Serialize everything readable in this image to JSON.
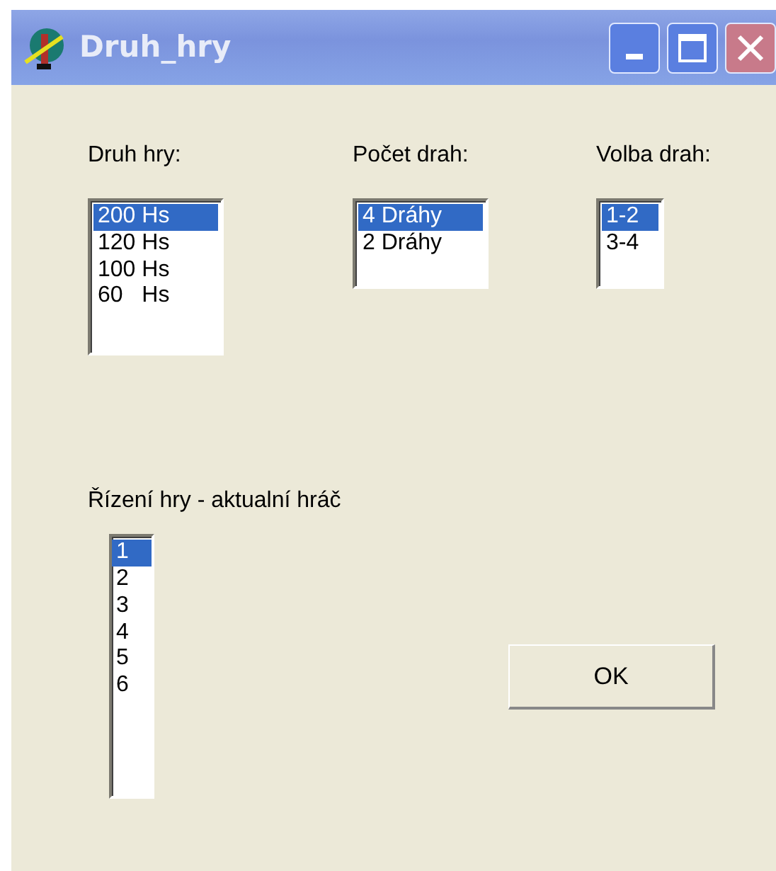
{
  "window": {
    "title": "Druh_hry"
  },
  "lists": [
    {
      "label": "Druh hry:",
      "items": [
        {
          "text": "200 Hs",
          "selected": true
        },
        {
          "text": "120 Hs",
          "selected": false
        },
        {
          "text": "100 Hs",
          "selected": false
        },
        {
          "text": "60   Hs",
          "selected": false
        }
      ]
    },
    {
      "label": "Počet drah:",
      "items": [
        {
          "text": "4 Dráhy",
          "selected": true
        },
        {
          "text": "2 Dráhy",
          "selected": false
        }
      ]
    },
    {
      "label": "Volba drah:",
      "items": [
        {
          "text": "1-2",
          "selected": true
        },
        {
          "text": "3-4",
          "selected": false
        }
      ]
    }
  ],
  "player_list": {
    "label": "Řízení hry - aktualní hráč",
    "items": [
      {
        "text": "1",
        "selected": true
      },
      {
        "text": "2",
        "selected": false
      },
      {
        "text": "3",
        "selected": false
      },
      {
        "text": "4",
        "selected": false
      },
      {
        "text": "5",
        "selected": false
      },
      {
        "text": "6",
        "selected": false
      }
    ]
  },
  "buttons": [
    "OK"
  ]
}
